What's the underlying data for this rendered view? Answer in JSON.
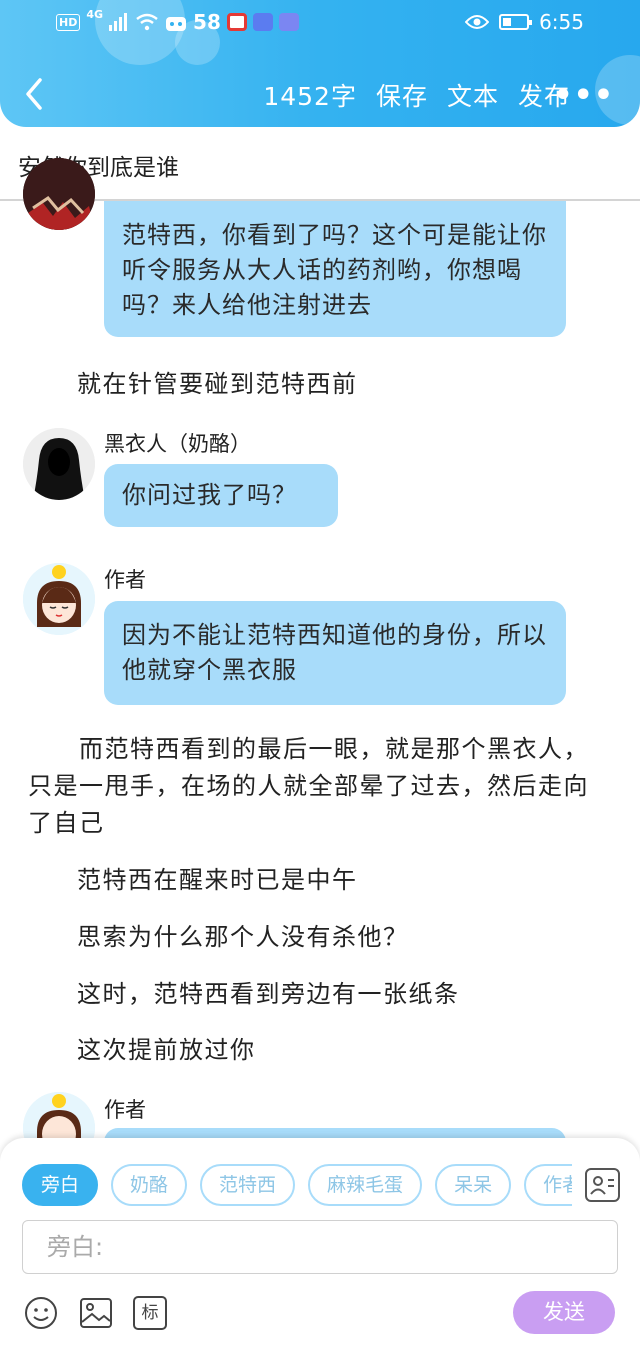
{
  "status_bar": {
    "left_text": "HD",
    "signal_label": "4G",
    "app_badge": "58",
    "time": "6:55"
  },
  "nav": {
    "word_count": "1452字",
    "save": "保存",
    "text": "文本",
    "publish": "发布",
    "more": "•••"
  },
  "title": "安然你到底是谁",
  "messages": {
    "m1": {
      "text": "范特西，你看到了吗？这个可是能让你听令服务从大人话的药剂哟，你想喝吗？来人给他注射进去"
    },
    "n1": "就在针管要碰到范特西前",
    "m2": {
      "speaker": "黑衣人（奶酪）",
      "text": "你问过我了吗？"
    },
    "m3": {
      "speaker": "作者",
      "text": "因为不能让范特西知道他的身份，所以他就穿个黑衣服"
    },
    "n2": "　　而范特西看到的最后一眼，就是那个黑衣人，只是一甩手，在场的人就全部晕了过去，然后走向了自己",
    "n3": "范特西在醒来时已是中午",
    "n4": "思索为什么那个人没有杀他？",
    "n5": "这时，范特西看到旁边有一张纸条",
    "n6": "这次提前放过你",
    "m4": {
      "speaker": "作者"
    }
  },
  "panel": {
    "chips": [
      "旁白",
      "奶酪",
      "范特西",
      "麻辣毛蛋",
      "呆呆",
      "作者"
    ],
    "input_placeholder": "旁白:",
    "tool_tag": "标",
    "send": "发送"
  },
  "colors": {
    "header": "#34b2f0",
    "bubble": "#a8dcfa",
    "send": "#c99ef2",
    "chip_active": "#39b2ef"
  }
}
